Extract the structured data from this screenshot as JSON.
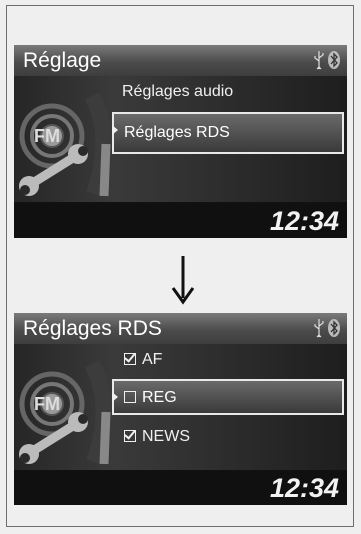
{
  "screen1": {
    "title": "Réglage",
    "items": [
      {
        "label": "Réglages audio",
        "selected": false
      },
      {
        "label": "Réglages RDS",
        "selected": true
      }
    ],
    "clock": "12:34",
    "badge": "FM"
  },
  "screen2": {
    "title": "Réglages RDS",
    "items": [
      {
        "label": "AF",
        "checked": true,
        "selected": false
      },
      {
        "label": "REG",
        "checked": false,
        "selected": true
      },
      {
        "label": "NEWS",
        "checked": true,
        "selected": false
      }
    ],
    "clock": "12:34",
    "badge": "FM"
  },
  "colors": {
    "highlight_border": "#e8e8e8",
    "background": "#111111",
    "titlebar": "#5a5a5a"
  },
  "icons": [
    "usb-icon",
    "bluetooth-icon",
    "wrench-icon",
    "fm-radio-icon",
    "down-arrow-icon"
  ]
}
